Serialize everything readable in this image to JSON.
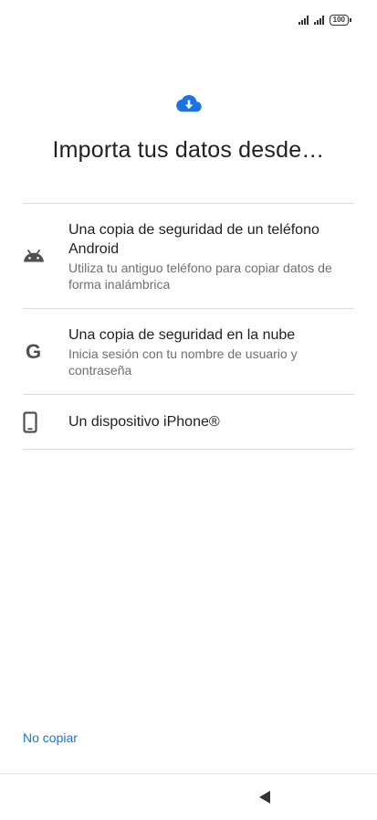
{
  "status_bar": {
    "battery_level": "100",
    "signal_icons": [
      "signal-1-icon",
      "signal-2-icon"
    ]
  },
  "header": {
    "icon": "cloud-download-icon",
    "title": "Importa tus datos desde…"
  },
  "options": [
    {
      "icon": "android-icon",
      "title": "Una copia de seguridad de un teléfono Android",
      "subtitle": "Utiliza tu antiguo teléfono para copiar datos de forma inalámbrica"
    },
    {
      "icon": "google-g-icon",
      "title": "Una copia de seguridad en la nube",
      "subtitle": "Inicia sesión con tu nombre de usuario y contraseña"
    },
    {
      "icon": "phone-icon",
      "title": "Un dispositivo iPhone®",
      "subtitle": ""
    }
  ],
  "footer": {
    "skip_label": "No copiar"
  },
  "nav": {
    "back_icon": "back-triangle-icon"
  },
  "colors": {
    "accent": "#1a73e8",
    "divider": "#dadce0",
    "icon_gray": "#505050"
  }
}
